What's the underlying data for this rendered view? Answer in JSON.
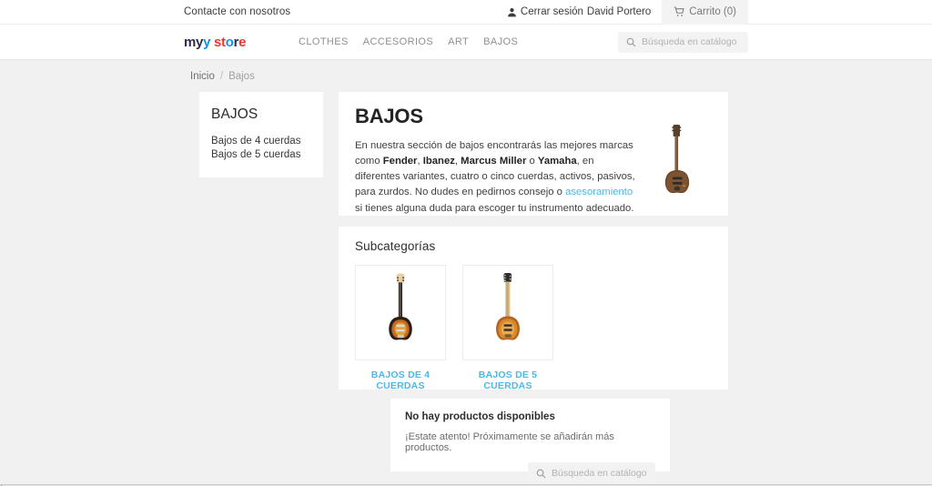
{
  "topbar": {
    "contact_label": "Contacte con nosotros",
    "signout_label": "Cerrar sesión",
    "username": "David Portero",
    "cart_label": "Carrito (0)",
    "user_icon": "user-icon",
    "cart_icon": "cart-icon"
  },
  "header": {
    "logo": {
      "part1": "my",
      "part2": " st",
      "part3": "o",
      "part4": "r",
      "part5": "e",
      "full": "my store"
    },
    "nav": [
      {
        "label": "CLOTHES"
      },
      {
        "label": "ACCESORIOS"
      },
      {
        "label": "ART"
      },
      {
        "label": "BAJOS"
      }
    ],
    "search": {
      "placeholder": "Búsqueda en catálogo",
      "value": "",
      "icon": "search-icon"
    }
  },
  "breadcrumb": {
    "home": "Inicio",
    "separator": "/",
    "current": "Bajos"
  },
  "sidebar": {
    "title": "BAJOS",
    "items": [
      {
        "label": "Bajos de 4 cuerdas"
      },
      {
        "label": "Bajos de 5 cuerdas"
      }
    ]
  },
  "main": {
    "title": "BAJOS",
    "description": {
      "p1": "En nuestra sección de bajos encontrarás las mejores marcas como ",
      "b1": "Fender",
      "p2": ", ",
      "b2": "Ibanez",
      "p3": ", ",
      "b3": "Marcus Miller",
      "p4": " o ",
      "b4": "Yamaha",
      "p5": ", en diferentes variantes, cuatro o cinco cuerdas, activos, pasivos, para zurdos. No dudes en pedirnos consejo o ",
      "link": "asesoramiento",
      "p6": " si tienes alguna duda para escoger tu instrumento adecuado."
    },
    "hero_image_alt": "bass-guitar-natural"
  },
  "subcategories": {
    "heading": "Subcategorías",
    "items": [
      {
        "label": "BAJOS DE 4 CUERDAS",
        "image_alt": "bass-guitar-sunburst"
      },
      {
        "label": "BAJOS DE 5 CUERDAS",
        "image_alt": "bass-guitar-amber"
      }
    ]
  },
  "no_products": {
    "title": "No hay productos disponibles",
    "subtitle": "¡Estate atento! Próximamente se añadirán más productos.",
    "search": {
      "placeholder": "Búsqueda en catálogo",
      "value": "",
      "icon": "search-icon"
    }
  },
  "colors": {
    "link_blue": "#4cb8e8",
    "page_bg": "#f1f1f1",
    "card_bg": "#ffffff",
    "logo_navy": "#2b2b4a",
    "logo_blue": "#1a8fe0",
    "logo_red": "#e8392e"
  }
}
